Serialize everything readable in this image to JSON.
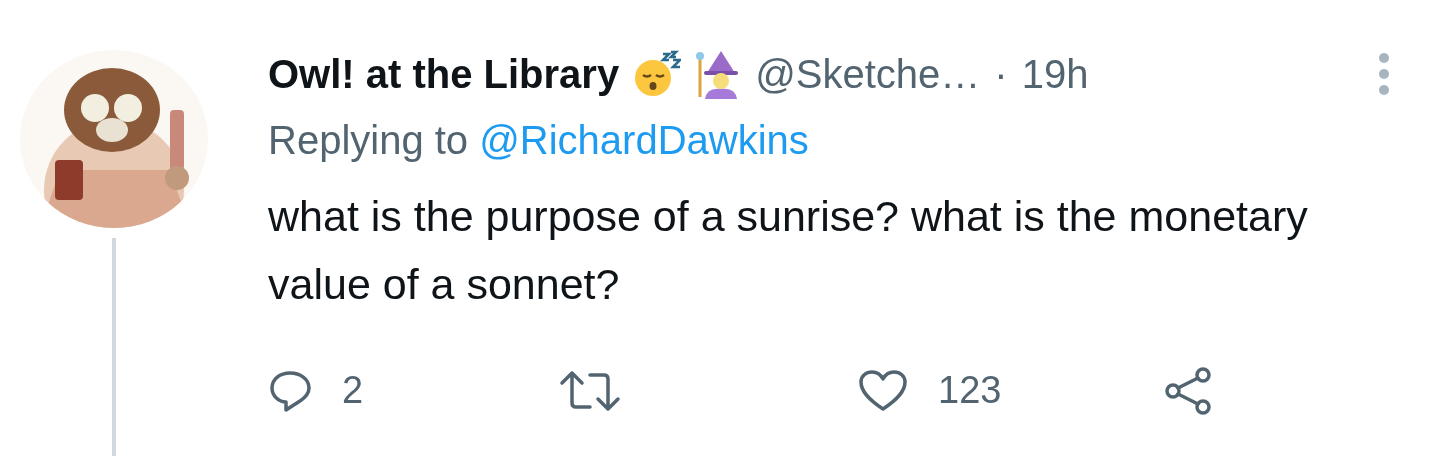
{
  "tweet": {
    "author_name": "Owl! at the Library",
    "handle": "@Sketche…",
    "separator": "·",
    "time": "19h",
    "reply_prefix": "Replying to",
    "reply_to": "@RichardDawkins",
    "text": "what is the purpose of a sunrise? what is the monetary value of a sonnet?",
    "actions": [
      {
        "kind": "reply",
        "count": "2"
      },
      {
        "kind": "retweet"
      },
      {
        "kind": "like",
        "count": "123"
      },
      {
        "kind": "share"
      }
    ]
  }
}
